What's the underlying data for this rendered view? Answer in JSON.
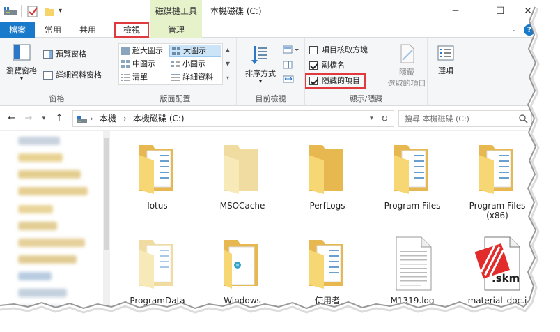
{
  "window": {
    "title": "本機磁碟 (C:)",
    "context_group": "磁碟機工具",
    "minimize": "─",
    "maximize": "☐",
    "close": "✕"
  },
  "tabs": {
    "file": "檔案",
    "home": "常用",
    "share": "共用",
    "view": "檢視",
    "manage": "管理",
    "collapse": "⌄",
    "help": "?"
  },
  "ribbon": {
    "panes": {
      "nav_pane": "瀏覽窗格",
      "preview_pane": "預覽窗格",
      "details_pane": "詳細資料窗格",
      "label": "窗格"
    },
    "layout": {
      "extra_large": "超大圖示",
      "large": "大圖示",
      "medium": "中圖示",
      "small": "小圖示",
      "list": "清單",
      "details": "詳細資料",
      "label": "版面配置"
    },
    "current_view": {
      "sort_by": "排序方式",
      "label": "目前檢視"
    },
    "show_hide": {
      "item_checkboxes": "項目核取方塊",
      "file_extensions": "副檔名",
      "hidden_items": "隱藏的項目",
      "hide_selected_1": "隱藏",
      "hide_selected_2": "選取的項目",
      "label": "顯示/隱藏"
    },
    "options": {
      "label": "選項"
    }
  },
  "address": {
    "crumb_1": "本機",
    "crumb_2": "本機磁碟 (C:)",
    "sep": "›",
    "search_placeholder": "搜尋 本機磁碟 (C:)"
  },
  "items": [
    {
      "name": "lotus",
      "kind": "folder-doc"
    },
    {
      "name": "MSOCache",
      "kind": "folder-light"
    },
    {
      "name": "PerfLogs",
      "kind": "folder"
    },
    {
      "name": "Program Files",
      "kind": "folder-doc"
    },
    {
      "name": "Program Files\n(x86)",
      "kind": "folder-doc"
    },
    {
      "name": "ProgramData",
      "kind": "folder-light-doc"
    },
    {
      "name": "Windows",
      "kind": "folder-win"
    },
    {
      "name": "使用者",
      "kind": "folder-doc"
    },
    {
      "name": "M1319.log",
      "kind": "text-file"
    },
    {
      "name": "material_doc.i",
      "kind": "skm-file",
      "badge": ".skm"
    }
  ],
  "colors": {
    "accent": "#1979ca",
    "context": "#e6f2c9",
    "highlight_box": "#e0393e",
    "folder": "#f7d774"
  }
}
